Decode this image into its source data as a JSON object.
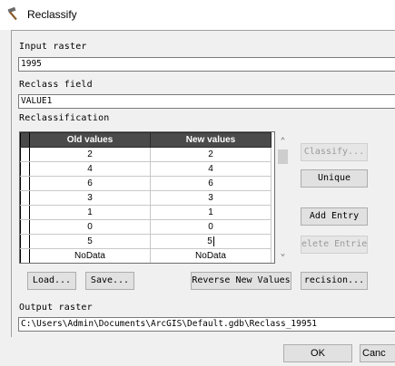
{
  "window": {
    "title": "Reclassify"
  },
  "input_raster": {
    "label": "Input raster",
    "value": "1995"
  },
  "reclass_field": {
    "label": "Reclass field",
    "value": "VALUE1"
  },
  "reclassification": {
    "label": "Reclassification",
    "columns": [
      "Old values",
      "New values"
    ],
    "rows": [
      {
        "old": "2",
        "new": "2"
      },
      {
        "old": "4",
        "new": "4"
      },
      {
        "old": "6",
        "new": "6"
      },
      {
        "old": "3",
        "new": "3"
      },
      {
        "old": "1",
        "new": "1"
      },
      {
        "old": "0",
        "new": "0"
      },
      {
        "old": "5",
        "new": "5"
      },
      {
        "old": "NoData",
        "new": "NoData"
      }
    ],
    "buttons": {
      "classify": "Classify...",
      "unique": "Unique",
      "add_entry": "Add Entry",
      "delete_entries": "elete Entrie",
      "load": "Load...",
      "save": "Save...",
      "reverse": "Reverse New Values",
      "precision": "recision..."
    }
  },
  "output_raster": {
    "label": "Output raster",
    "value": "C:\\Users\\Admin\\Documents\\ArcGIS\\Default.gdb\\Reclass_19951"
  },
  "footer": {
    "ok": "OK",
    "cancel": "Canc"
  }
}
